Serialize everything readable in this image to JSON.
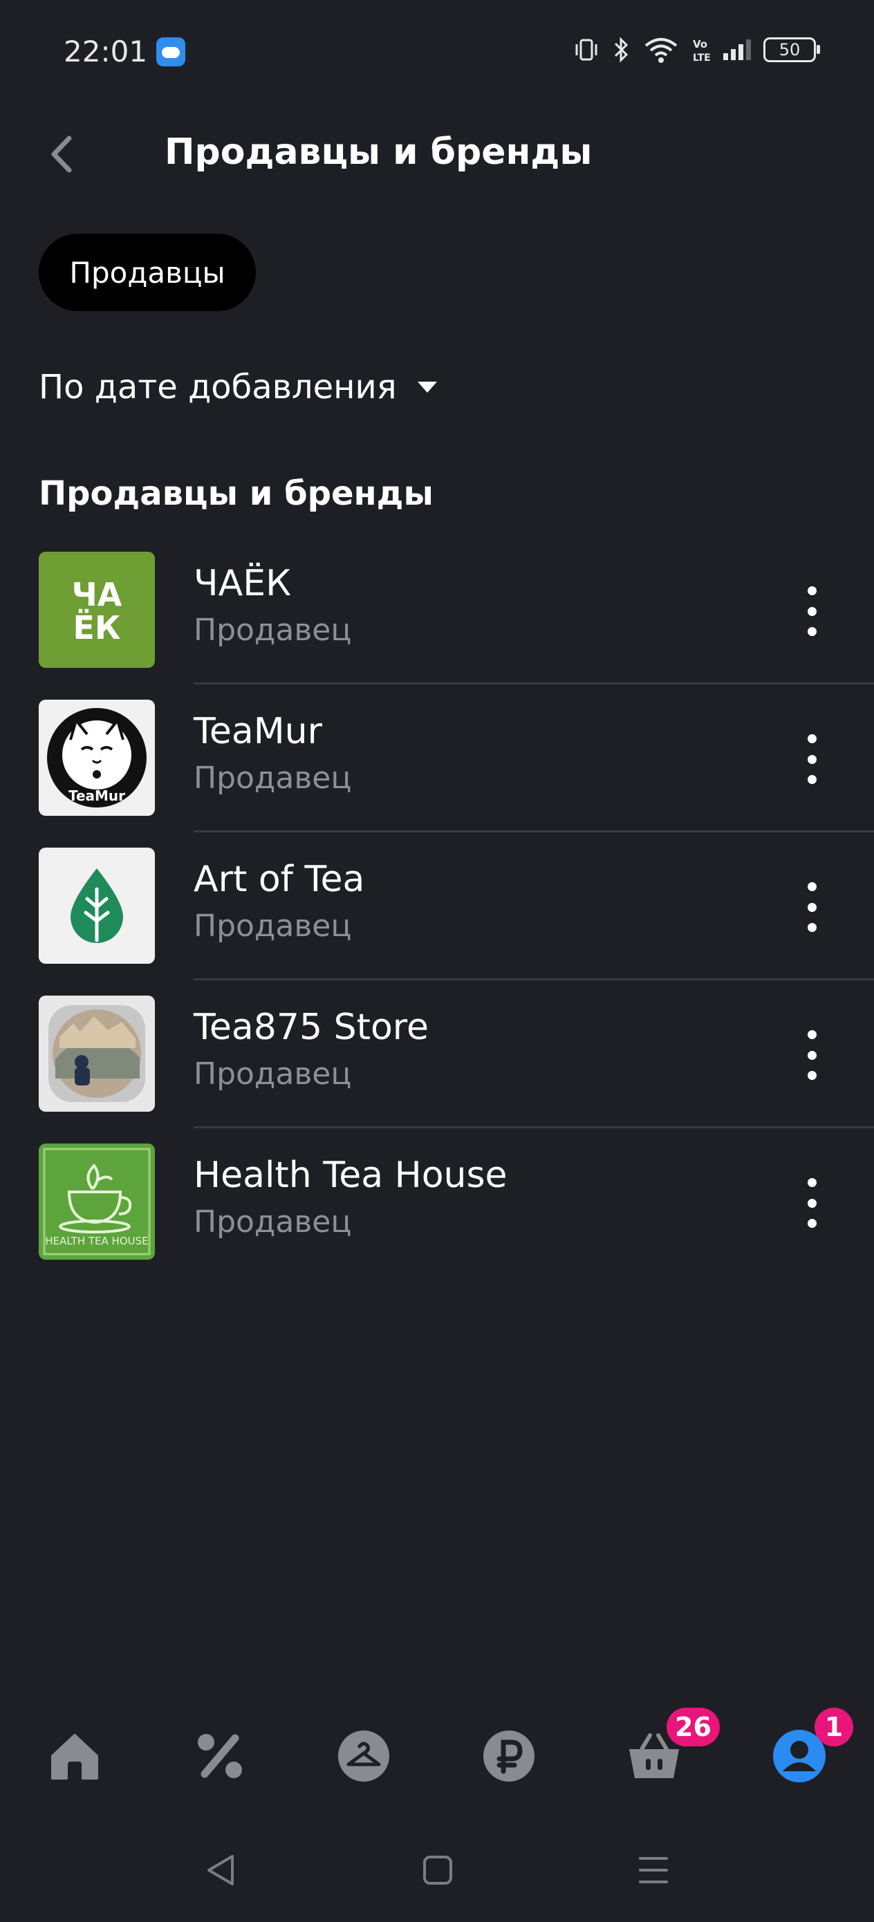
{
  "status_bar": {
    "time": "22:01",
    "battery": "50",
    "icons": [
      "weather-icon",
      "vibrate-icon",
      "bluetooth-icon",
      "wifi-icon",
      "volte-icon",
      "signal-icon",
      "battery-icon"
    ]
  },
  "header": {
    "title": "Продавцы и бренды",
    "back_icon": "chevron-left-icon"
  },
  "filter": {
    "chip_label": "Продавцы"
  },
  "sort": {
    "label": "По дате добавления"
  },
  "section": {
    "title": "Продавцы и бренды"
  },
  "sellers": [
    {
      "name": "ЧАЁК",
      "type": "Продавец",
      "logo_text": "ЧА ЁК",
      "logo_color": "#6f9e35"
    },
    {
      "name": "TeaMur",
      "type": "Продавец",
      "logo_text": "TeaMur",
      "logo_color": "#f1f1f1"
    },
    {
      "name": "Art of Tea",
      "type": "Продавец",
      "logo_color": "#f1f1f1"
    },
    {
      "name": "Tea875 Store",
      "type": "Продавец",
      "logo_color": "#e8e8e8"
    },
    {
      "name": "Health Tea House",
      "type": "Продавец",
      "logo_text": "HEALTH TEA HOUSE",
      "logo_color": "#5da43d"
    }
  ],
  "bottom_nav": {
    "items": [
      "home-icon",
      "percent-icon",
      "hanger-icon",
      "ruble-icon",
      "basket-icon",
      "profile-icon"
    ],
    "cart_badge": "26",
    "profile_badge": "1",
    "active_color": "#2a8cf0",
    "badge_color": "#e8167a"
  },
  "system_nav": {
    "items": [
      "back-triangle-icon",
      "home-square-icon",
      "menu-lines-icon"
    ]
  }
}
